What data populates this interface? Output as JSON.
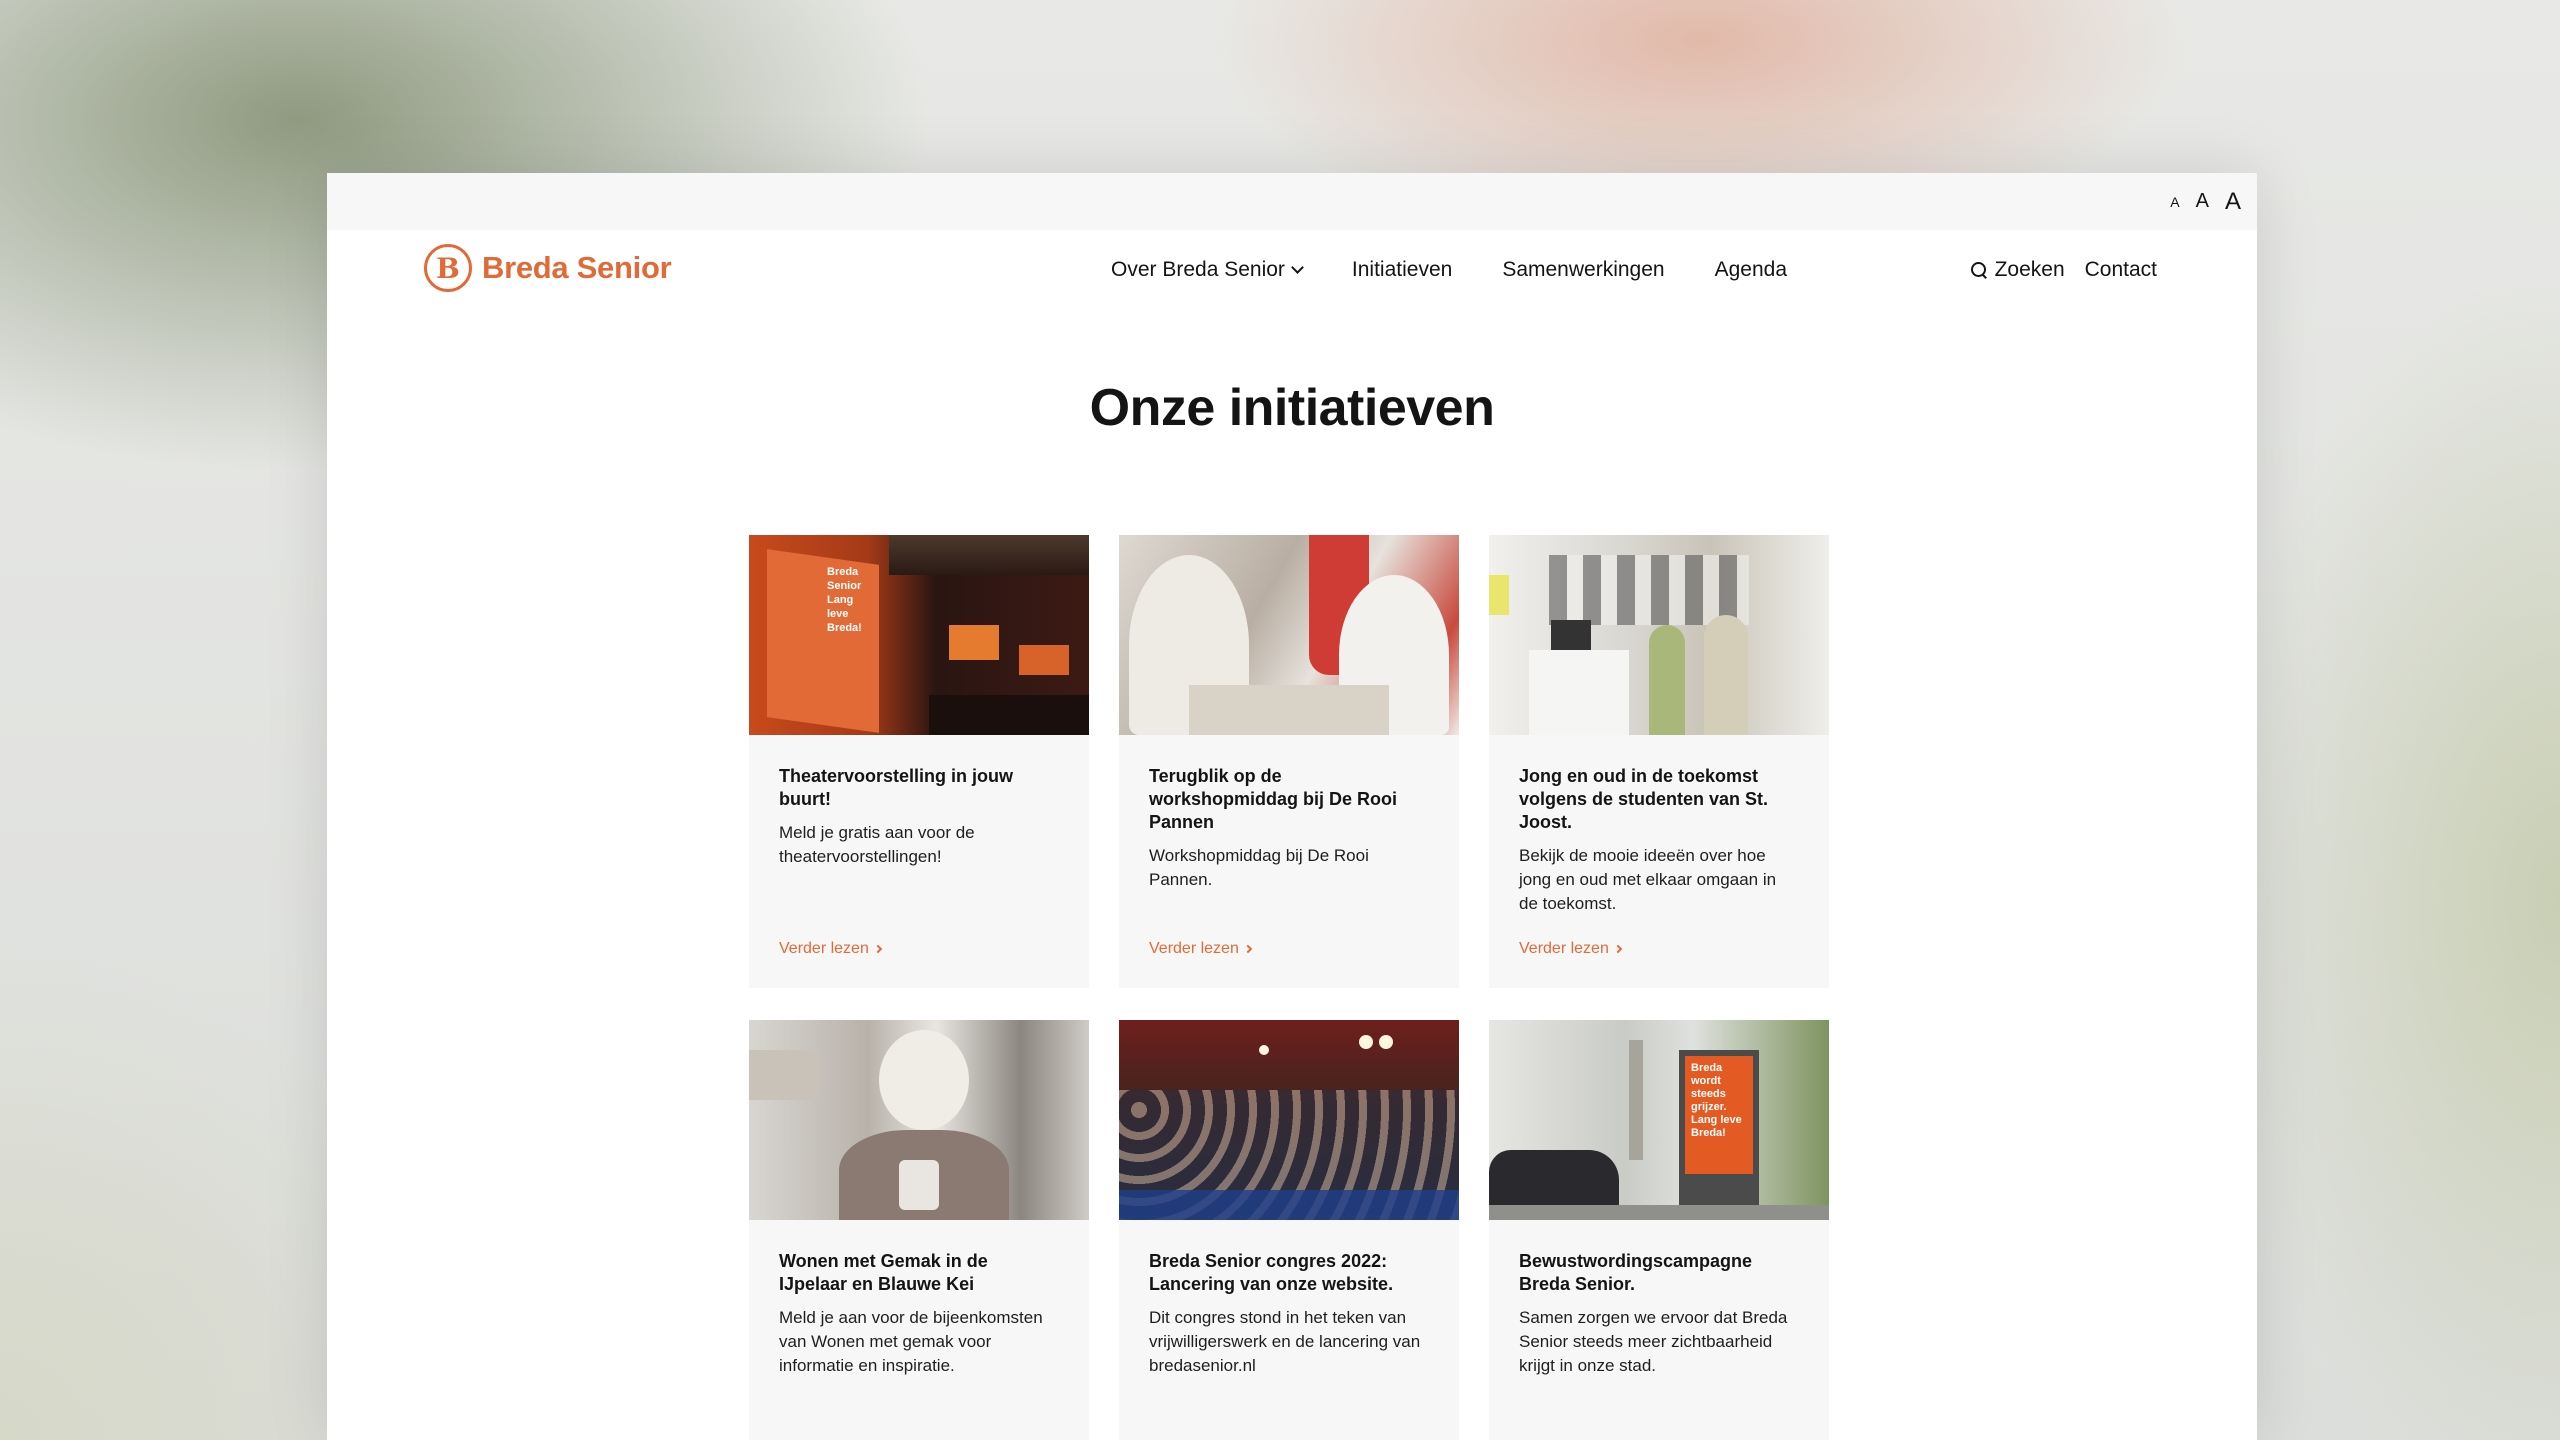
{
  "accessibility": {
    "font_small": "A",
    "font_medium": "A",
    "font_large": "A"
  },
  "brand": {
    "logo_letter": "B",
    "name": "Breda Senior",
    "accent": "#e26a37"
  },
  "nav": {
    "items": [
      {
        "label": "Over Breda Senior",
        "has_dropdown": true
      },
      {
        "label": "Initiatieven"
      },
      {
        "label": "Samenwerkingen"
      },
      {
        "label": "Agenda"
      }
    ],
    "search_label": "Zoeken",
    "contact_label": "Contact"
  },
  "main": {
    "title": "Onze initiatieven",
    "read_more": "Verder lezen",
    "cards": [
      {
        "title": "Theatervoorstelling in jouw buurt!",
        "text": "Meld je gratis aan voor de theatervoorstellingen!",
        "image_overlay": "Breda Senior Lang leve Breda!"
      },
      {
        "title": "Terugblik op de workshopmiddag bij De Rooi Pannen",
        "text": "Workshopmiddag bij De Rooi Pannen."
      },
      {
        "title": "Jong en oud in de toekomst volgens de studenten van St. Joost.",
        "text": "Bekijk de mooie ideeën over hoe jong en oud met elkaar omgaan in de toekomst."
      },
      {
        "title": "Wonen met Gemak in de IJpelaar en Blauwe Kei",
        "text": "Meld je aan voor de bijeenkomsten van Wonen met gemak voor informatie en inspiratie."
      },
      {
        "title": "Breda Senior congres 2022: Lancering van onze website.",
        "text": "Dit congres stond in het teken van vrijwilligerswerk en de lancering van bredasenior.nl"
      },
      {
        "title": "Bewustwordingscampagne Breda Senior.",
        "text": "Samen zorgen we ervoor dat Breda Senior steeds meer zichtbaarheid krijgt in onze stad.",
        "image_overlay": "Breda wordt steeds grijzer. Lang leve Breda!"
      }
    ]
  }
}
